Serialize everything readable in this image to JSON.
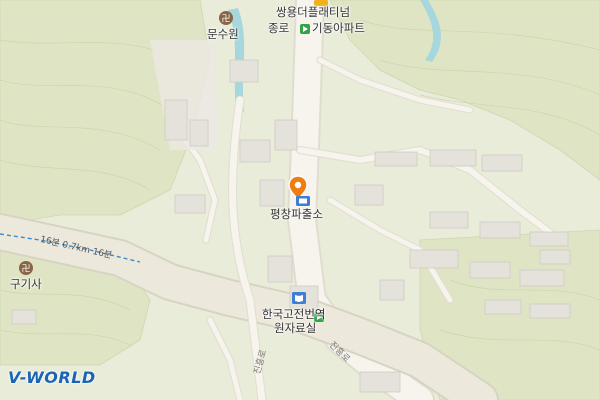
{
  "map": {
    "labels": {
      "munsuwon": "문수원",
      "apartment_line1": "쌍용더플래티넘",
      "apartment_line2": "종로",
      "apartment_line2b": "기동아파트",
      "police": "평창파출소",
      "gugisa": "구기사",
      "library_line1": "한국고전번역",
      "library_line2": "원자료실",
      "trail": "16분 0.7km 16분",
      "road_jinheung_1": "진흥로",
      "road_jinheung_2": "진흥로"
    },
    "logo": {
      "text": "V-WORLD",
      "accent": "#1b64b5",
      "text_color": "#ffffff"
    },
    "colors": {
      "land": "#e9ecd9",
      "forest": "#dde3c2",
      "road": "#f6f4ec",
      "road_stroke": "#e0ddd0",
      "water": "#a6d7dd",
      "building": "#e5e2dc",
      "pin": "#ef7d12"
    }
  }
}
